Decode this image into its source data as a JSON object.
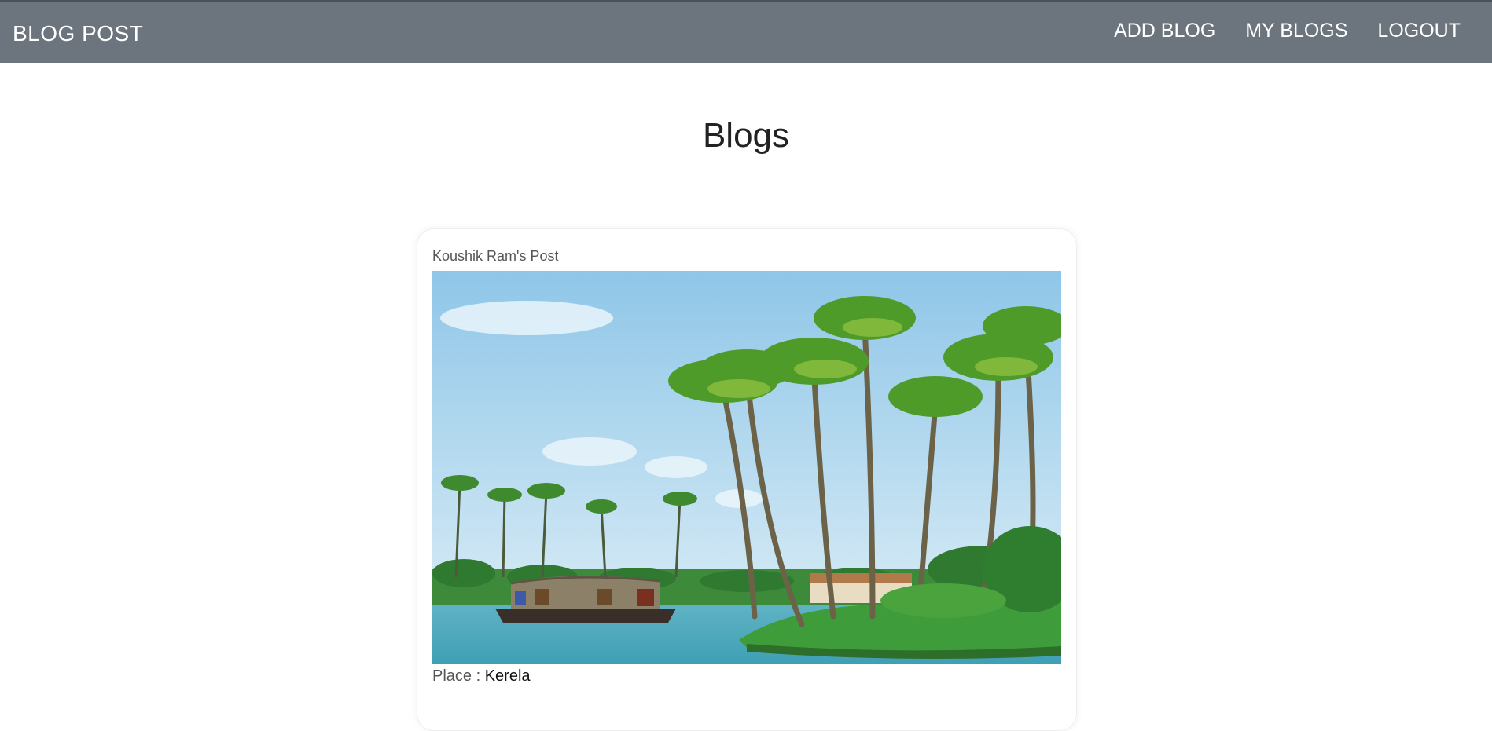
{
  "navbar": {
    "brand": "BLOG POST",
    "links": [
      {
        "label": "ADD BLOG"
      },
      {
        "label": "MY BLOGS"
      },
      {
        "label": "LOGOUT"
      }
    ],
    "background": "#6c757d"
  },
  "page": {
    "title": "Blogs"
  },
  "post": {
    "author": "Koushik Ram's Post",
    "image_icon": "landscape-photo",
    "place_label": "Place :",
    "place_value": "Kerela"
  }
}
